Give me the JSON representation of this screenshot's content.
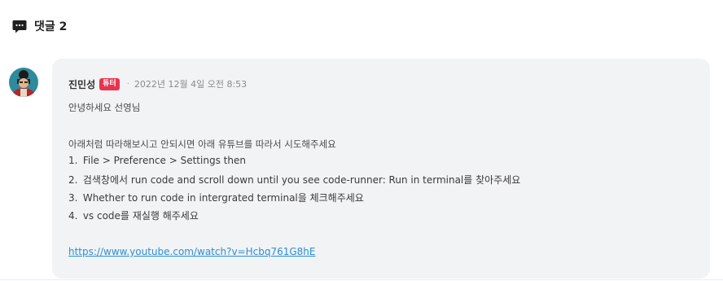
{
  "comments_header": {
    "icon": "speech-bubble-icon",
    "title": "댓글 2"
  },
  "comment": {
    "author": "진민성",
    "badge": "튜터",
    "separator": "·",
    "timestamp": "2022년 12월 4일 오전 8:53",
    "greeting": "안녕하세요 선영님",
    "intro": "아래처럼 따라해보시고 안되시면 아래 유튜브를 따라서 시도해주세요",
    "steps": [
      "File > Preference > Settings then",
      "검색창에서 run code and scroll down until you see code-runner: Run in terminal를 찾아주세요",
      "Whether to run code in intergrated terminal을 체크해주세요",
      "vs code를 재실행 해주세요"
    ],
    "step_numbers": [
      "1.",
      "2.",
      "3.",
      "4."
    ],
    "link": "https://www.youtube.com/watch?v=Hcbq761G8hE"
  },
  "colors": {
    "badge_bg": "#e8344e",
    "card_bg": "#f2f3f5",
    "link": "#2a8fd6"
  }
}
